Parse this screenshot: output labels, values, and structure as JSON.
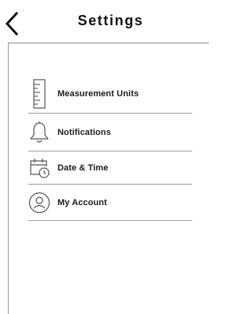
{
  "header": {
    "title": "Settings",
    "back_icon": "chevron-left-icon"
  },
  "menu": {
    "items": [
      {
        "label": "Measurement Units",
        "icon": "ruler-icon"
      },
      {
        "label": "Notifications",
        "icon": "bell-icon"
      },
      {
        "label": "Date & Time",
        "icon": "calendar-clock-icon"
      },
      {
        "label": "My Account",
        "icon": "user-circle-icon"
      }
    ]
  },
  "colors": {
    "text": "#111111",
    "icon_stroke": "#555555",
    "divider": "#9d9d9d",
    "background": "#ffffff"
  }
}
